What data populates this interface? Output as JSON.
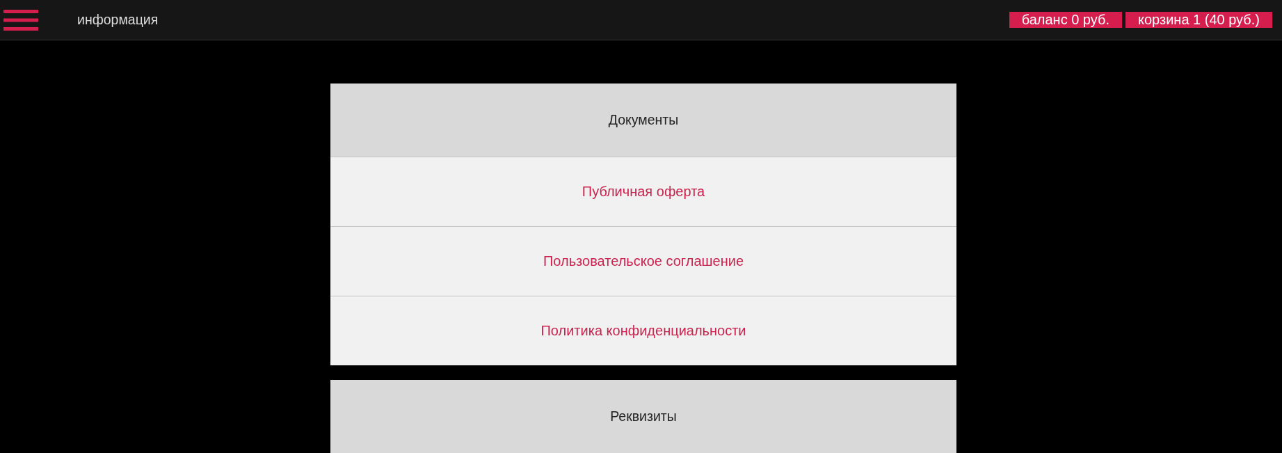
{
  "top_bar": {
    "page_title": "информация",
    "badges": [
      "баланс 0 руб.",
      "корзина 1 (40 руб.)"
    ]
  },
  "sections": [
    {
      "title": "Документы",
      "links": [
        "Публичная оферта",
        "Пользовательское соглашение",
        "Политика конфиденциальности"
      ]
    },
    {
      "title": "Реквизиты"
    }
  ]
}
